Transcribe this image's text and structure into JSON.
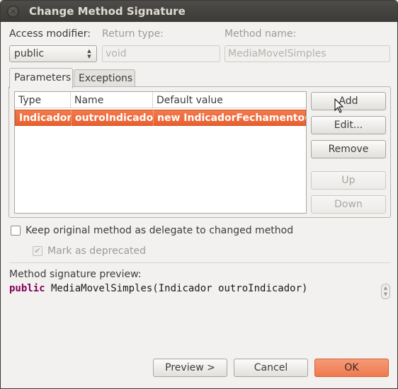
{
  "window": {
    "title": "Change Method Signature"
  },
  "form": {
    "access_modifier_label": "Access modifier:",
    "access_modifier_value": "public",
    "return_type_label": "Return type:",
    "return_type_value": "void",
    "method_name_label": "Method name:",
    "method_name_value": "MediaMovelSimples"
  },
  "tabs": [
    {
      "label": "Parameters",
      "active": true
    },
    {
      "label": "Exceptions",
      "active": false
    }
  ],
  "table": {
    "columns": [
      "Type",
      "Name",
      "Default value"
    ],
    "rows": [
      {
        "type": "Indicador",
        "name": "outroIndicador",
        "default_value": "new IndicadorFechamento()",
        "selected": true
      }
    ]
  },
  "side_buttons": {
    "add": "Add",
    "edit": "Edit...",
    "remove": "Remove",
    "up": "Up",
    "down": "Down"
  },
  "options": {
    "keep_delegate_label": "Keep original method as delegate to changed method",
    "keep_delegate_checked": false,
    "mark_deprecated_label": "Mark as deprecated",
    "mark_deprecated_checked": true
  },
  "preview": {
    "label": "Method signature preview:",
    "keyword": "public",
    "signature": " MediaMovelSimples(Indicador outroIndicador)"
  },
  "footer": {
    "preview_button": "Preview >",
    "cancel_button": "Cancel",
    "ok_button": "OK"
  },
  "colors": {
    "selection": "#e95f2f",
    "ok_button": "#ee7a4f",
    "keyword": "#7f0055",
    "titlebar": "#3c3b37"
  }
}
